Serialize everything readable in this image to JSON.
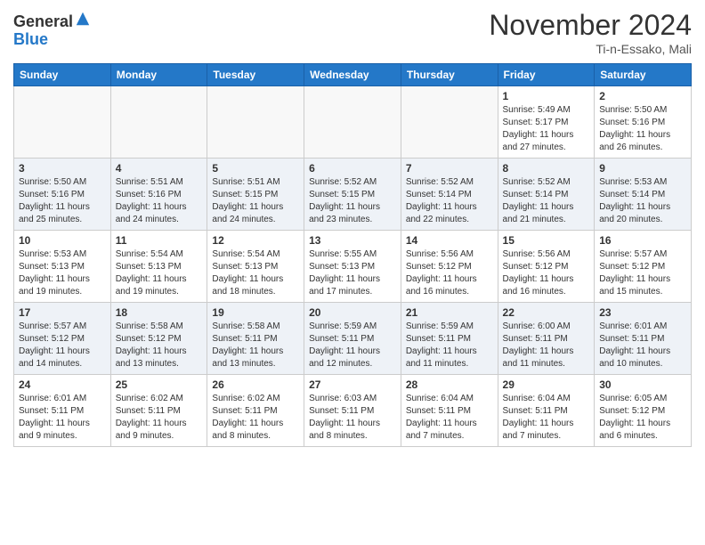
{
  "header": {
    "logo_line1": "General",
    "logo_line2": "Blue",
    "month": "November 2024",
    "location": "Ti-n-Essako, Mali"
  },
  "weekdays": [
    "Sunday",
    "Monday",
    "Tuesday",
    "Wednesday",
    "Thursday",
    "Friday",
    "Saturday"
  ],
  "weeks": [
    [
      {
        "day": "",
        "info": ""
      },
      {
        "day": "",
        "info": ""
      },
      {
        "day": "",
        "info": ""
      },
      {
        "day": "",
        "info": ""
      },
      {
        "day": "",
        "info": ""
      },
      {
        "day": "1",
        "info": "Sunrise: 5:49 AM\nSunset: 5:17 PM\nDaylight: 11 hours\nand 27 minutes."
      },
      {
        "day": "2",
        "info": "Sunrise: 5:50 AM\nSunset: 5:16 PM\nDaylight: 11 hours\nand 26 minutes."
      }
    ],
    [
      {
        "day": "3",
        "info": "Sunrise: 5:50 AM\nSunset: 5:16 PM\nDaylight: 11 hours\nand 25 minutes."
      },
      {
        "day": "4",
        "info": "Sunrise: 5:51 AM\nSunset: 5:16 PM\nDaylight: 11 hours\nand 24 minutes."
      },
      {
        "day": "5",
        "info": "Sunrise: 5:51 AM\nSunset: 5:15 PM\nDaylight: 11 hours\nand 24 minutes."
      },
      {
        "day": "6",
        "info": "Sunrise: 5:52 AM\nSunset: 5:15 PM\nDaylight: 11 hours\nand 23 minutes."
      },
      {
        "day": "7",
        "info": "Sunrise: 5:52 AM\nSunset: 5:14 PM\nDaylight: 11 hours\nand 22 minutes."
      },
      {
        "day": "8",
        "info": "Sunrise: 5:52 AM\nSunset: 5:14 PM\nDaylight: 11 hours\nand 21 minutes."
      },
      {
        "day": "9",
        "info": "Sunrise: 5:53 AM\nSunset: 5:14 PM\nDaylight: 11 hours\nand 20 minutes."
      }
    ],
    [
      {
        "day": "10",
        "info": "Sunrise: 5:53 AM\nSunset: 5:13 PM\nDaylight: 11 hours\nand 19 minutes."
      },
      {
        "day": "11",
        "info": "Sunrise: 5:54 AM\nSunset: 5:13 PM\nDaylight: 11 hours\nand 19 minutes."
      },
      {
        "day": "12",
        "info": "Sunrise: 5:54 AM\nSunset: 5:13 PM\nDaylight: 11 hours\nand 18 minutes."
      },
      {
        "day": "13",
        "info": "Sunrise: 5:55 AM\nSunset: 5:13 PM\nDaylight: 11 hours\nand 17 minutes."
      },
      {
        "day": "14",
        "info": "Sunrise: 5:56 AM\nSunset: 5:12 PM\nDaylight: 11 hours\nand 16 minutes."
      },
      {
        "day": "15",
        "info": "Sunrise: 5:56 AM\nSunset: 5:12 PM\nDaylight: 11 hours\nand 16 minutes."
      },
      {
        "day": "16",
        "info": "Sunrise: 5:57 AM\nSunset: 5:12 PM\nDaylight: 11 hours\nand 15 minutes."
      }
    ],
    [
      {
        "day": "17",
        "info": "Sunrise: 5:57 AM\nSunset: 5:12 PM\nDaylight: 11 hours\nand 14 minutes."
      },
      {
        "day": "18",
        "info": "Sunrise: 5:58 AM\nSunset: 5:12 PM\nDaylight: 11 hours\nand 13 minutes."
      },
      {
        "day": "19",
        "info": "Sunrise: 5:58 AM\nSunset: 5:11 PM\nDaylight: 11 hours\nand 13 minutes."
      },
      {
        "day": "20",
        "info": "Sunrise: 5:59 AM\nSunset: 5:11 PM\nDaylight: 11 hours\nand 12 minutes."
      },
      {
        "day": "21",
        "info": "Sunrise: 5:59 AM\nSunset: 5:11 PM\nDaylight: 11 hours\nand 11 minutes."
      },
      {
        "day": "22",
        "info": "Sunrise: 6:00 AM\nSunset: 5:11 PM\nDaylight: 11 hours\nand 11 minutes."
      },
      {
        "day": "23",
        "info": "Sunrise: 6:01 AM\nSunset: 5:11 PM\nDaylight: 11 hours\nand 10 minutes."
      }
    ],
    [
      {
        "day": "24",
        "info": "Sunrise: 6:01 AM\nSunset: 5:11 PM\nDaylight: 11 hours\nand 9 minutes."
      },
      {
        "day": "25",
        "info": "Sunrise: 6:02 AM\nSunset: 5:11 PM\nDaylight: 11 hours\nand 9 minutes."
      },
      {
        "day": "26",
        "info": "Sunrise: 6:02 AM\nSunset: 5:11 PM\nDaylight: 11 hours\nand 8 minutes."
      },
      {
        "day": "27",
        "info": "Sunrise: 6:03 AM\nSunset: 5:11 PM\nDaylight: 11 hours\nand 8 minutes."
      },
      {
        "day": "28",
        "info": "Sunrise: 6:04 AM\nSunset: 5:11 PM\nDaylight: 11 hours\nand 7 minutes."
      },
      {
        "day": "29",
        "info": "Sunrise: 6:04 AM\nSunset: 5:11 PM\nDaylight: 11 hours\nand 7 minutes."
      },
      {
        "day": "30",
        "info": "Sunrise: 6:05 AM\nSunset: 5:12 PM\nDaylight: 11 hours\nand 6 minutes."
      }
    ]
  ]
}
